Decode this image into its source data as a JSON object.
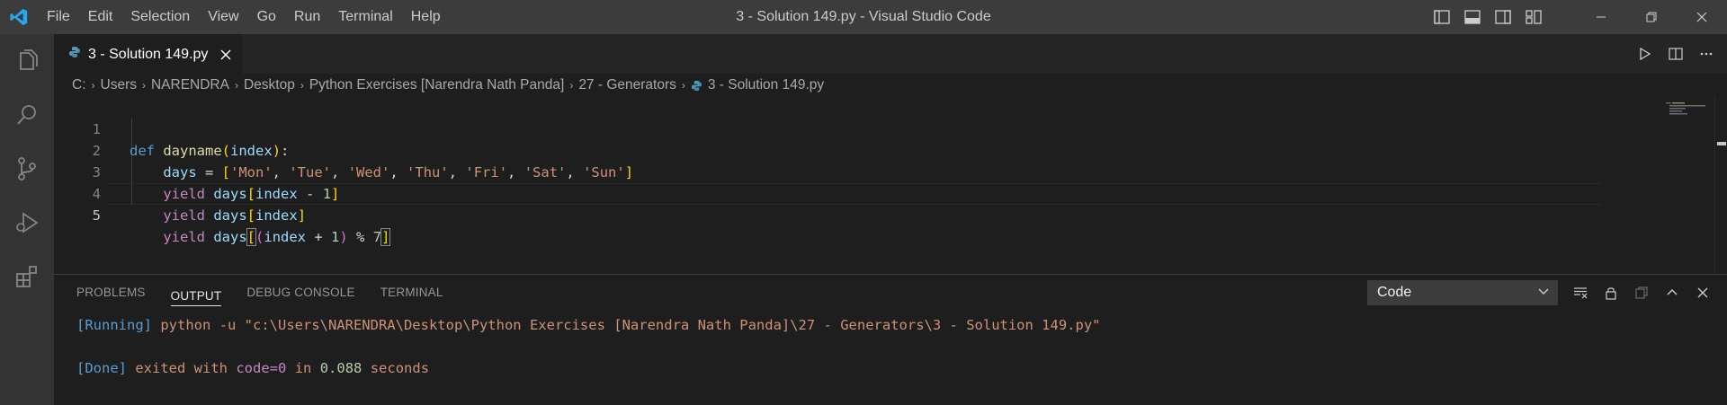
{
  "titlebar": {
    "menu": [
      "File",
      "Edit",
      "Selection",
      "View",
      "Go",
      "Run",
      "Terminal",
      "Help"
    ],
    "window_title": "3 - Solution 149.py - Visual Studio Code"
  },
  "colors": {
    "accent": "#007acc",
    "python_icon": "#519aba"
  },
  "tab": {
    "label": "3 - Solution 149.py",
    "icon": "python-file-icon"
  },
  "breadcrumbs": [
    "C:",
    "Users",
    "NARENDRA",
    "Desktop",
    "Python Exercises [Narendra Nath Panda]",
    "27 - Generators",
    "3 - Solution 149.py"
  ],
  "editor": {
    "line_numbers": [
      "1",
      "2",
      "3",
      "4",
      "5"
    ],
    "lines": [
      "def dayname(index):",
      "    days = ['Mon', 'Tue', 'Wed', 'Thu', 'Fri', 'Sat', 'Sun']",
      "    yield days[index - 1]",
      "    yield days[index]",
      "    yield days[(index + 1) % 7]"
    ]
  },
  "panel": {
    "tabs": [
      "PROBLEMS",
      "OUTPUT",
      "DEBUG CONSOLE",
      "TERMINAL"
    ],
    "active_tab": "OUTPUT",
    "channel": "Code",
    "output": {
      "running_tag": "[Running]",
      "running_cmd": "python -u \"c:\\Users\\NARENDRA\\Desktop\\Python Exercises [Narendra Nath Panda]\\27 - Generators\\3 - Solution 149.py\"",
      "done_tag": "[Done]",
      "done_text_1": "exited with",
      "done_code": "code=0",
      "done_text_2": "in",
      "done_time": "0.088",
      "done_text_3": "seconds"
    }
  }
}
